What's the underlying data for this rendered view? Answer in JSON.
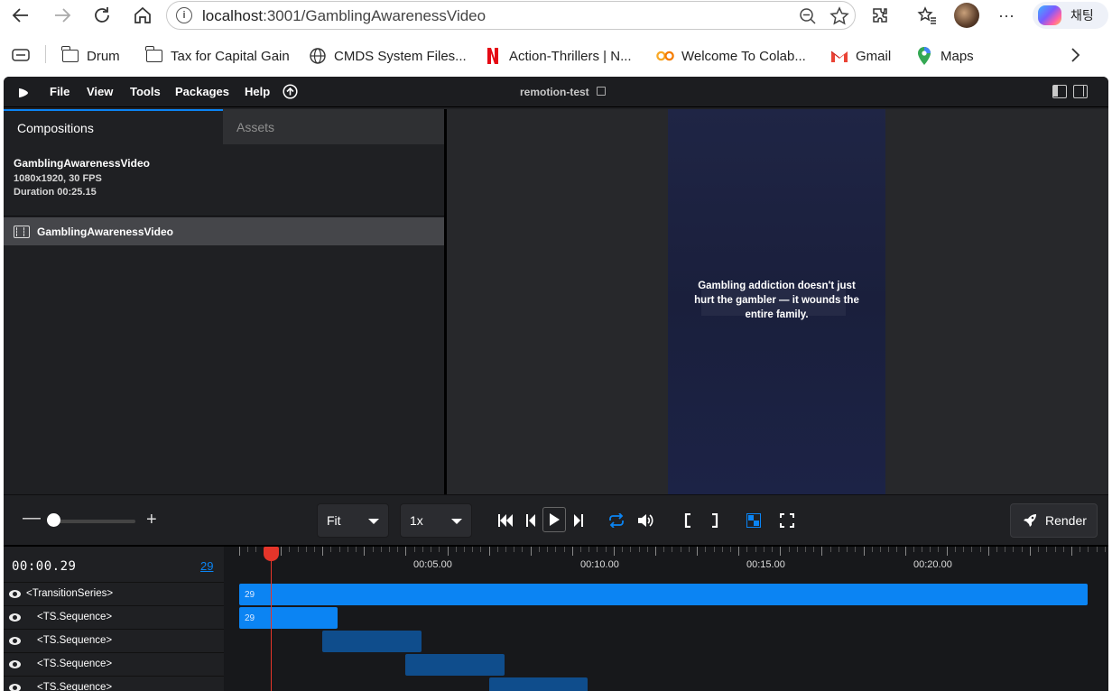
{
  "browser": {
    "url_host": "localhost",
    "url_rest": ":3001/GamblingAwarenessVideo",
    "copilot_label": "채팅",
    "bookmarks": [
      {
        "label": "Drum",
        "icon": "folder-icon"
      },
      {
        "label": "Tax for Capital Gain",
        "icon": "folder-icon"
      },
      {
        "label": "CMDS System Files...",
        "icon": "globe-icon"
      },
      {
        "label": "Action-Thrillers | N...",
        "icon": "netflix-icon"
      },
      {
        "label": "Welcome To Colab...",
        "icon": "colab-icon"
      },
      {
        "label": "Gmail",
        "icon": "gmail-icon"
      },
      {
        "label": "Maps",
        "icon": "maps-icon"
      }
    ]
  },
  "app": {
    "title": "remotion-test",
    "menu": [
      "File",
      "View",
      "Tools",
      "Packages",
      "Help"
    ],
    "tabs": {
      "compositions": "Compositions",
      "assets": "Assets"
    },
    "composition": {
      "name": "GamblingAwarenessVideo",
      "size_fps": "1080x1920, 30 FPS",
      "duration": "Duration 00:25.15"
    },
    "composition_list_item": "GamblingAwarenessVideo",
    "preview_caption": "Gambling addiction doesn't just hurt the gambler — it wounds the entire family.",
    "controls": {
      "fit_label": "Fit",
      "speed_label": "1x",
      "render_label": "Render"
    },
    "timeline": {
      "current_time": "00:00.29",
      "current_frame": "29",
      "ruler_labels": [
        "00:05.00",
        "00:10.00",
        "00:15.00",
        "00:20.00"
      ],
      "rows": [
        "<TransitionSeries>",
        "<TS.Sequence>",
        "<TS.Sequence>",
        "<TS.Sequence>",
        "<TS.Sequence>"
      ],
      "track_labels": [
        "29",
        "29"
      ]
    }
  },
  "colors": {
    "accent": "#0b84f3",
    "playhead": "#e5352a",
    "track_active": "#0b84f3",
    "track_inactive": "#0f4d8c"
  }
}
